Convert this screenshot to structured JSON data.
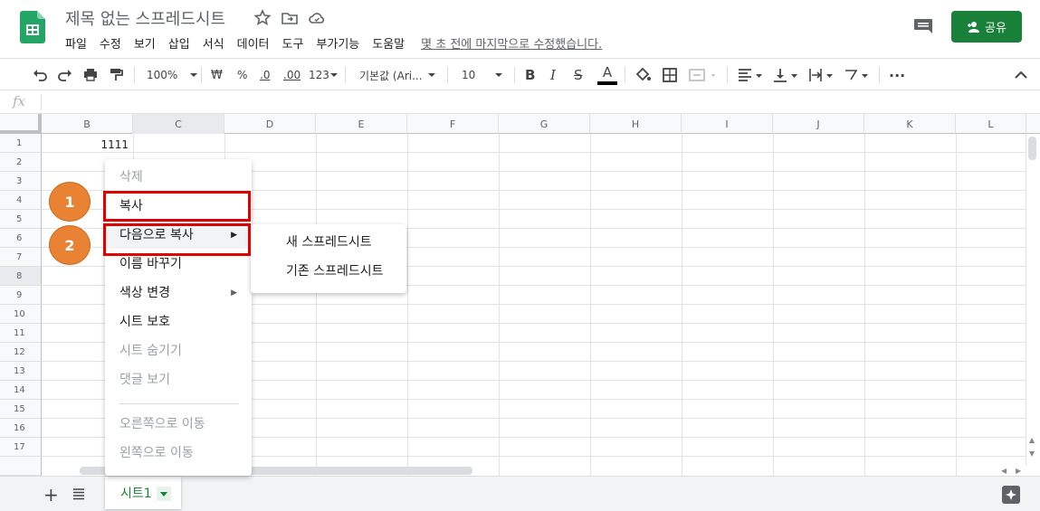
{
  "header": {
    "title": "제목 없는 스프레드시트",
    "menu": [
      "파일",
      "수정",
      "보기",
      "삽입",
      "서식",
      "데이터",
      "도구",
      "부가기능",
      "도움말"
    ],
    "last_edit": "몇 초 전에 마지막으로 수정했습니다.",
    "share_label": "공유",
    "icons": [
      "star-icon",
      "move-folder-icon",
      "cloud-icon",
      "comment-icon"
    ],
    "accent": "#188038"
  },
  "toolbar": {
    "zoom": "100%",
    "currency": "₩",
    "percent": "%",
    "dec_less": ".0",
    "dec_more": ".00",
    "format_more": "123",
    "font": "기본값 (Ari...",
    "font_size": "10"
  },
  "formula_bar": {
    "fx": "fx",
    "value": ""
  },
  "grid": {
    "columns": [
      "B",
      "C",
      "D",
      "E",
      "F",
      "G",
      "H",
      "I",
      "J",
      "K",
      "L"
    ],
    "rows": [
      "1",
      "2",
      "3",
      "4",
      "5",
      "6",
      "7",
      "8",
      "9",
      "10",
      "11",
      "12",
      "13",
      "14",
      "15",
      "16",
      "17"
    ],
    "selected_column": "C",
    "selected_row": "8",
    "cells": {
      "B1": "1111"
    }
  },
  "context_menu": {
    "items": [
      {
        "label": "삭제",
        "disabled": true
      },
      {
        "label": "복사",
        "disabled": false
      },
      {
        "label": "다음으로 복사",
        "disabled": false,
        "submenu": true
      },
      {
        "label": "이름 바꾸기",
        "disabled": false
      },
      {
        "label": "색상 변경",
        "disabled": false,
        "submenu": true
      },
      {
        "label": "시트 보호",
        "disabled": false
      },
      {
        "label": "시트 숨기기",
        "disabled": true
      },
      {
        "label": "댓글 보기",
        "disabled": true
      },
      {
        "label": "오른쪽으로 이동",
        "disabled": true
      },
      {
        "label": "왼쪽으로 이동",
        "disabled": true
      }
    ],
    "submenu_items": [
      "새 스프레드시트",
      "기존 스프레드시트"
    ]
  },
  "sheets": {
    "add": "+",
    "tabs": [
      "시트1"
    ]
  },
  "annotations": {
    "badges": [
      "1",
      "2"
    ],
    "highlight_color": "#e10000",
    "badge_color": "#e98333"
  }
}
